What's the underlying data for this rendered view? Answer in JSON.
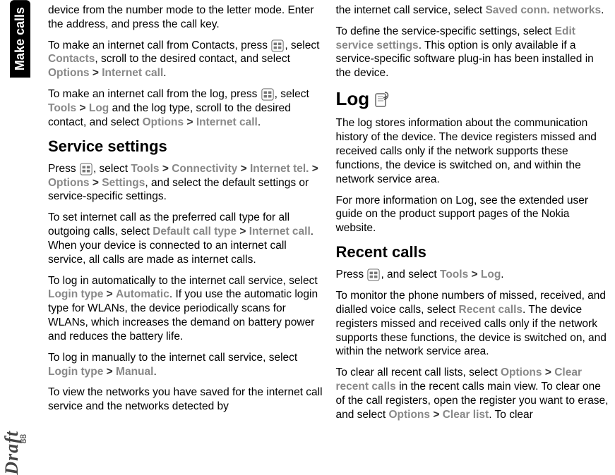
{
  "sidebar": {
    "tab_label": "Make calls",
    "draft_label": "Draft",
    "page_number": "88"
  },
  "col1": {
    "p1_a": "device from the number mode to the letter mode. Enter the address, and press the call key.",
    "p2_a": "To make an internet call from Contacts, press ",
    "p2_b": ", select ",
    "p2_ui1": "Contacts",
    "p2_c": ", scroll to the desired contact, and select ",
    "p2_ui2": "Options",
    "p2_ui3": "Internet call",
    "p2_d": ".",
    "p3_a": "To make an internet call from the log, press ",
    "p3_b": ", select ",
    "p3_ui1": "Tools",
    "p3_ui2": "Log",
    "p3_c": " and the log type, scroll to the desired contact, and select ",
    "p3_ui3": "Options",
    "p3_ui4": "Internet call",
    "p3_d": ".",
    "h_service": "Service settings",
    "p4_a": "Press ",
    "p4_b": ", select ",
    "p4_ui1": "Tools",
    "p4_ui2": "Connectivity",
    "p4_ui3": "Internet tel.",
    "p4_ui4": "Options",
    "p4_ui5": "Settings",
    "p4_c": ", and select the default settings or service-specific settings.",
    "p5_a": "To set internet call as the preferred call type for all outgoing calls, select ",
    "p5_ui1": "Default call type",
    "p5_ui2": "Internet call",
    "p5_b": ". When your device is connected to an internet call service, all calls are made as internet calls.",
    "p6_a": "To log in automatically to the internet call service, select ",
    "p6_ui1": "Login type",
    "p6_ui2": "Automatic",
    "p6_b": ". If you use the automatic login type for WLANs, the device periodically scans for WLANs, which increases the demand on battery power and reduces the battery life.",
    "p7_a": "To log in manually to the internet call service, select ",
    "p7_ui1": "Login type",
    "p7_ui2": "Manual",
    "p7_b": ".",
    "p8_a": "To view the networks you have saved for the internet call service and the networks detected by"
  },
  "col2": {
    "p1_a": "the internet call service, select ",
    "p1_ui1": "Saved conn. networks",
    "p1_b": ".",
    "p2_a": "To define the service-specific settings, select ",
    "p2_ui1": "Edit service settings",
    "p2_b": ". This option is only available if a service-specific software plug-in has been installed in the device.",
    "h_log": "Log",
    "p3_a": "The log stores information about the communication history of the device. The device registers missed and received calls only if the network supports these functions, the device is switched on, and within the network service area.",
    "p4_a": "For more information on Log, see the extended user guide on the product support pages of the Nokia website.",
    "h_recent": "Recent calls",
    "p5_a": "Press ",
    "p5_b": ", and select ",
    "p5_ui1": "Tools",
    "p5_ui2": "Log",
    "p5_c": ".",
    "p6_a": "To monitor the phone numbers of missed, received, and dialled voice calls, select ",
    "p6_ui1": "Recent calls",
    "p6_b": ". The device registers missed and received calls only if the network supports these functions, the device is switched on, and within the network service area.",
    "p7_a": "To clear all recent call lists, select ",
    "p7_ui1": "Options",
    "p7_ui2": "Clear recent calls",
    "p7_b": " in the recent calls main view. To clear one of the call registers, open the register you want to erase, and select ",
    "p7_ui3": "Options",
    "p7_ui4": "Clear list",
    "p7_c": ". To clear"
  },
  "sep": ">"
}
